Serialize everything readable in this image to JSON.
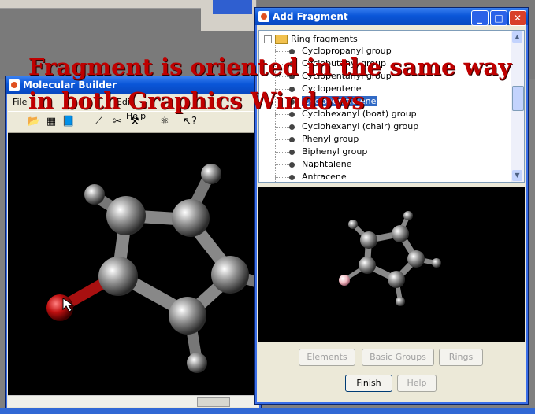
{
  "mol_builder": {
    "title": "Molecular Builder",
    "menu": [
      "File",
      "Edit",
      "Help"
    ],
    "toolbar_icons": [
      "open-icon",
      "save-icon",
      "book-icon",
      "bond-icon",
      "scissors-icon",
      "hammer-icon",
      "atoms-icon",
      "pointer-help-icon"
    ]
  },
  "add_fragment": {
    "title": "Add Fragment",
    "tree_root": "Ring fragments",
    "tree_items": [
      "Cyclopropanyl group",
      "Cyclobutanyl group",
      "Cyclopentanyl group",
      "Cyclopentene",
      "Cyclopentadiene",
      "Cyclohexanyl (boat) group",
      "Cyclohexanyl (chair) group",
      "Phenyl group",
      "Biphenyl group",
      "Naphtalene",
      "Antracene"
    ],
    "selected_index": 4,
    "buttons": {
      "elements": "Elements",
      "basic_groups": "Basic Groups",
      "rings": "Rings",
      "finish": "Finish",
      "help": "Help"
    }
  },
  "overlay": {
    "line1": "Fragment is oriented in the same way",
    "line2": "in both Graphics Windows"
  },
  "colors": {
    "overlay_text": "#c00000",
    "titlebar": "#0a56d8",
    "selection": "#316ac5"
  }
}
